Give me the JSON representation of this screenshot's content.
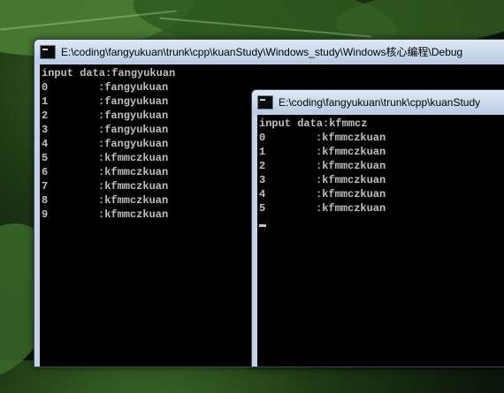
{
  "window1": {
    "title": "E:\\coding\\fangyukuan\\trunk\\cpp\\kuanStudy\\Windows_study\\Windows核心编程\\Debug",
    "header": "input data:fangyukuan",
    "rows": [
      {
        "idx": "0",
        "val": ":fangyukuan"
      },
      {
        "idx": "1",
        "val": ":fangyukuan"
      },
      {
        "idx": "2",
        "val": ":fangyukuan"
      },
      {
        "idx": "3",
        "val": ":fangyukuan"
      },
      {
        "idx": "4",
        "val": ":fangyukuan"
      },
      {
        "idx": "5",
        "val": ":kfmmczkuan"
      },
      {
        "idx": "6",
        "val": ":kfmmczkuan"
      },
      {
        "idx": "7",
        "val": ":kfmmczkuan"
      },
      {
        "idx": "8",
        "val": ":kfmmczkuan"
      },
      {
        "idx": "9",
        "val": ":kfmmczkuan"
      }
    ]
  },
  "window2": {
    "title": "E:\\coding\\fangyukuan\\trunk\\cpp\\kuanStudy",
    "header": "input data:kfmmcz",
    "rows": [
      {
        "idx": "0",
        "val": ":kfmmczkuan"
      },
      {
        "idx": "1",
        "val": ":kfmmczkuan"
      },
      {
        "idx": "2",
        "val": ":kfmmczkuan"
      },
      {
        "idx": "3",
        "val": ":kfmmczkuan"
      },
      {
        "idx": "4",
        "val": ":kfmmczkuan"
      },
      {
        "idx": "5",
        "val": ":kfmmczkuan"
      }
    ]
  },
  "icons": {
    "app_icon": "console-app-icon"
  }
}
